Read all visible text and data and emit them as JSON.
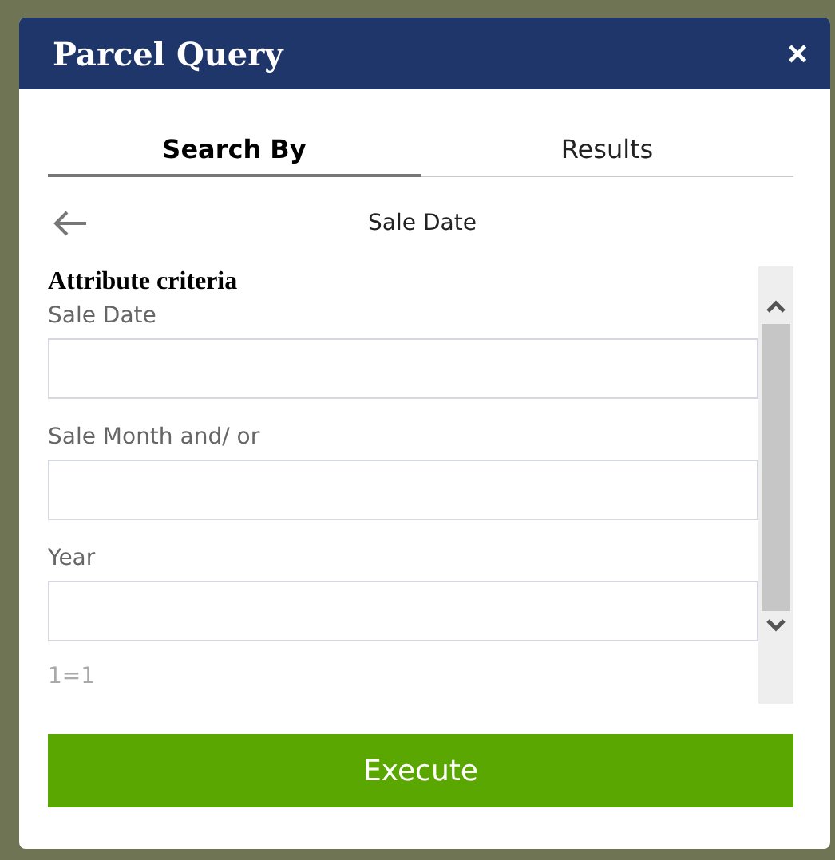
{
  "window": {
    "title": "Parcel Query",
    "close": "×"
  },
  "tabs": [
    {
      "label": "Search By",
      "selected": true
    },
    {
      "label": "Results",
      "selected": false
    }
  ],
  "header": {
    "title": "Sale Date"
  },
  "criteria": {
    "heading": "Attribute criteria",
    "fields": [
      {
        "label": "Sale Date"
      },
      {
        "label": "Sale Month and/ or"
      },
      {
        "label": "Year"
      }
    ],
    "expression": "1=1"
  },
  "execute_button": "Execute"
}
